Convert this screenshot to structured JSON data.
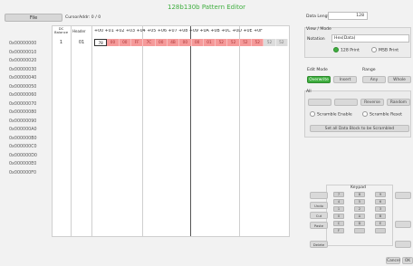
{
  "title": "128b130b Pattern Editor",
  "file_label": "File",
  "cursor_addr": "CursorAddr: 0 / 0",
  "grid": {
    "bit_balance_label": "DC Balance",
    "header_label": "Header",
    "columns": "+00 +01 +02 +03 +04 +05 +06 +07 +08 +09 +0A +0B +0C +0D +0E +0F",
    "addresses": [
      "0x00000000",
      "0x00000010",
      "0x00000020",
      "0x00000030",
      "0x00000040",
      "0x00000050",
      "0x00000060",
      "0x00000070",
      "0x00000080",
      "0x00000090",
      "0x000000A0",
      "0x000000B0",
      "0x000000C0",
      "0x000000D0",
      "0x000000E0",
      "0x000000F0"
    ],
    "row1_bit": "1",
    "row1_header": "01",
    "row1_cells": [
      "78",
      "00",
      "00",
      "FF",
      "7C",
      "00",
      "4B",
      "00",
      "00",
      "01",
      "52",
      "52",
      "52",
      "52",
      "52",
      "52"
    ]
  },
  "data_length": {
    "label": "Data Length",
    "value": "128"
  },
  "view_mode": {
    "title": "View / Mode",
    "notation_label": "Notation",
    "notation_value": "Hex(Data)",
    "opt1": "128 Print",
    "opt2": "MSB Print"
  },
  "edit_mode": {
    "title": "Edit Mode",
    "overwrite": "Overwrite",
    "insert": "Insert"
  },
  "range": {
    "title": "Range",
    "any": "Any",
    "whole": "Whole"
  },
  "all_section": {
    "title": "All",
    "reverse": "Reverse",
    "random": "Random",
    "scramble_enable": "Scramble Enable",
    "scramble_reset": "Scramble Reset",
    "set_all": "Set all Data Block to be Scrambled"
  },
  "keypad": {
    "title": "Keypad",
    "keys": [
      "7",
      "8",
      "9",
      "4",
      "5",
      "6",
      "1",
      "2",
      "3",
      "0",
      "A",
      "B",
      "C",
      "D",
      "E",
      "F",
      "",
      ""
    ],
    "left_buttons": [
      "",
      "Undo",
      "Cut",
      "Paste"
    ],
    "delete_label": "Delete",
    "right_buttons": [
      "",
      "",
      ""
    ]
  },
  "bottom": {
    "cancel": "Cancel",
    "ok": "OK"
  },
  "colors": {
    "accent": "#3fae3f",
    "cell_red": "#f59a9a"
  }
}
